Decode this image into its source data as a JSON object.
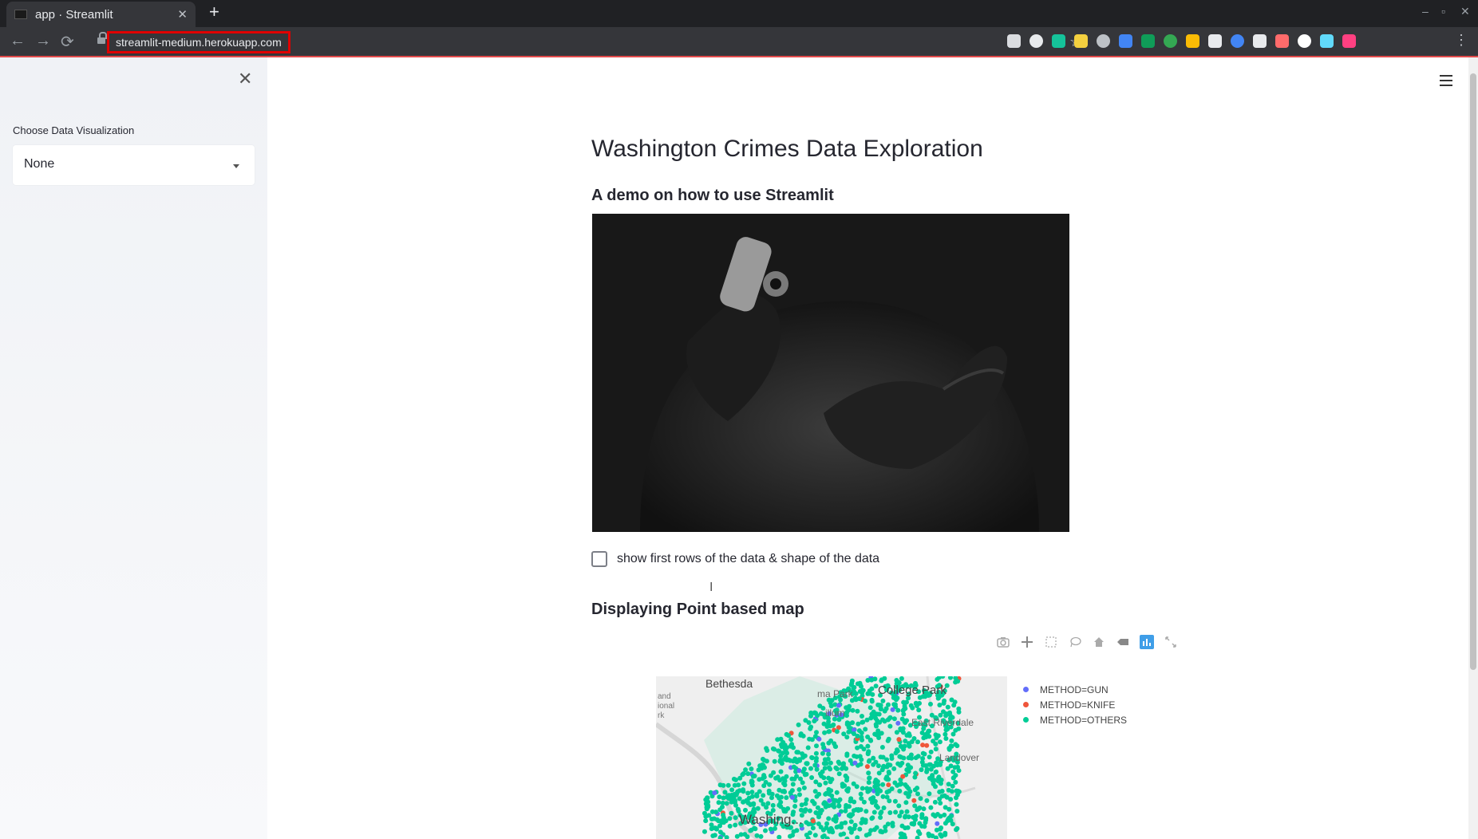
{
  "browser": {
    "tab_title": "app · Streamlit",
    "tab_close": "✕",
    "new_tab": "+",
    "url": "streamlit-medium.herokuapp.com",
    "window_controls": [
      "–",
      "▫",
      "✕"
    ],
    "nav": {
      "back": "←",
      "forward": "→",
      "reload": "⟳"
    },
    "bookmark": "☆",
    "menu": "⋮",
    "extension_colors": [
      "#dadce0",
      "#e8eaed",
      "#15c39a",
      "#f4d03f",
      "#bdc1c6",
      "#4285f4",
      "#0f9d58",
      "#34a853",
      "#fbbc05",
      "#e8eaed",
      "#4285f4",
      "#e8eaed",
      "#ff6b6b",
      "#ffffff",
      "#61dafb",
      "#ff4081"
    ]
  },
  "sidebar": {
    "close": "✕",
    "label": "Choose Data Visualization",
    "select_value": "None"
  },
  "main": {
    "title": "Washington Crimes Data Exploration",
    "subtitle": "A demo on how to use Streamlit",
    "checkbox_label": "show first rows of the data & shape of the data",
    "cursor": "I",
    "section_title": "Displaying Point based map"
  },
  "map": {
    "places": [
      "Bethesda",
      "College Park",
      "East Riverdale",
      "Landover",
      "Washing...",
      "ma Park",
      "illum",
      "and",
      "ional",
      "rk"
    ],
    "legend": [
      {
        "label": "METHOD=GUN",
        "color": "#636efa"
      },
      {
        "label": "METHOD=KNIFE",
        "color": "#ef553b"
      },
      {
        "label": "METHOD=OTHERS",
        "color": "#00cc96"
      }
    ]
  }
}
